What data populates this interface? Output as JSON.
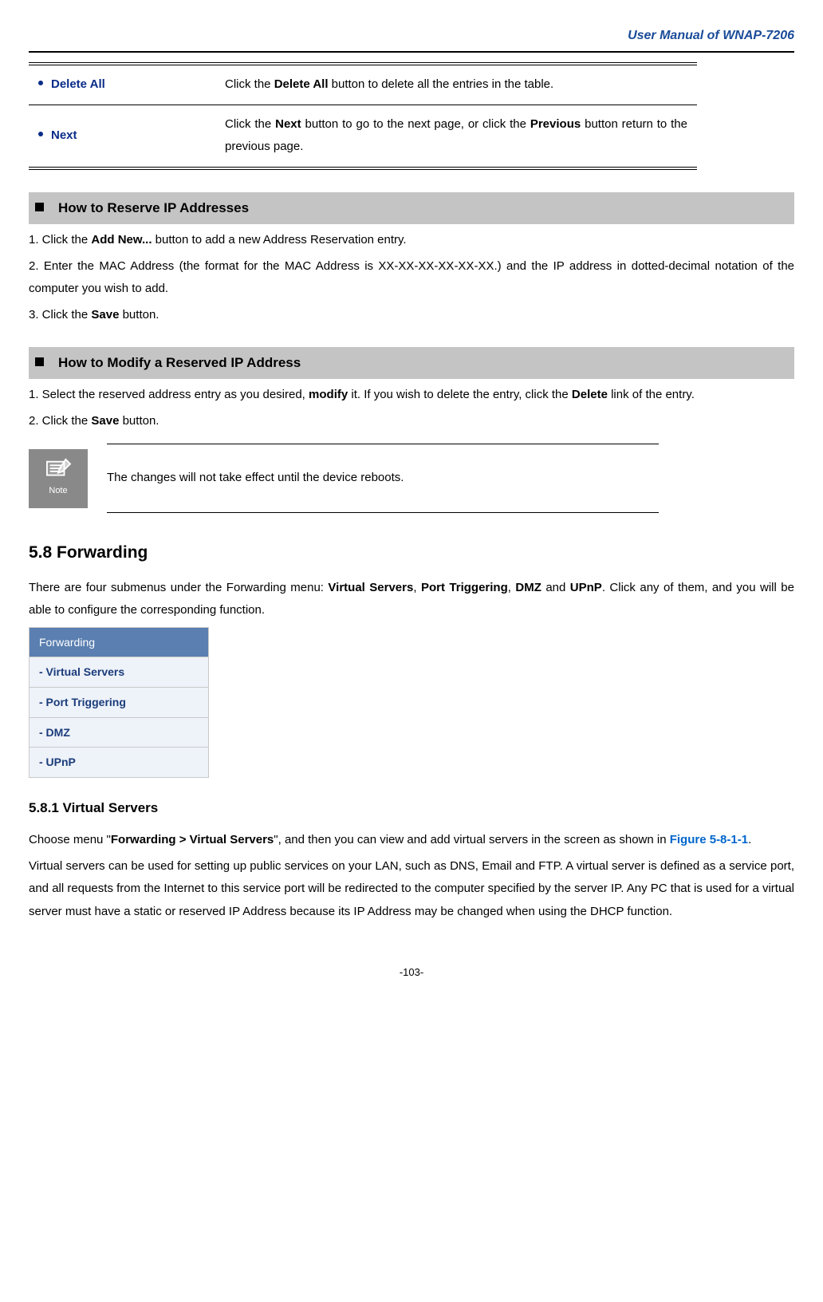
{
  "header": {
    "title": "User Manual of WNAP-7206"
  },
  "defTable": {
    "rows": [
      {
        "label": "Delete All",
        "desc_pre": "Click the ",
        "b1": "Delete All",
        "desc_post": " button to delete all the entries in the table."
      },
      {
        "label": "Next",
        "desc_pre": "Click the ",
        "b1": "Next",
        "desc_mid": " button to go to the next page, or click the ",
        "b2": "Previous",
        "desc_post": " button return to the previous page."
      }
    ]
  },
  "section1": {
    "title": "How to Reserve IP Addresses",
    "step1_pre": "1. Click the ",
    "step1_b": "Add New...",
    "step1_post": " button to add a new Address Reservation entry.",
    "step2": "2. Enter the MAC Address (the format for the MAC Address is XX-XX-XX-XX-XX-XX.) and the IP address in dotted-decimal notation of the computer you wish to add.",
    "step3_pre": "3. Click the ",
    "step3_b": "Save",
    "step3_post": " button."
  },
  "section2": {
    "title": "How to Modify a Reserved IP Address",
    "step1_pre": "1. Select the reserved address entry as you desired, ",
    "step1_b1": "modify",
    "step1_mid": " it. If you wish to delete the entry, click the ",
    "step1_b2": "Delete",
    "step1_post": " link of the entry.",
    "step2_pre": "2. Click the ",
    "step2_b": "Save",
    "step2_post": " button."
  },
  "note": {
    "label": "Note",
    "text": "The changes will not take effect until the device reboots."
  },
  "forwarding": {
    "heading": "5.8  Forwarding",
    "intro_pre": "There are four submenus under the Forwarding menu: ",
    "m1": "Virtual Servers",
    "c1": ", ",
    "m2": "Port Triggering",
    "c2": ", ",
    "m3": "DMZ",
    "c3": " and ",
    "m4": "UPnP",
    "intro_post": ". Click any of them, and you will be able to configure the corresponding function.",
    "menu": {
      "header": "Forwarding",
      "items": [
        "- Virtual Servers",
        "- Port Triggering",
        "- DMZ",
        "- UPnP"
      ]
    }
  },
  "virtualServers": {
    "heading": "5.8.1  Virtual Servers",
    "p1_pre": "Choose menu \"",
    "p1_b": "Forwarding > Virtual Servers",
    "p1_mid": "\", and then you can view and add virtual servers in the screen as shown in ",
    "p1_link": "Figure 5-8-1-1",
    "p1_post": ".",
    "p2": "Virtual servers can be used for setting up public services on your LAN, such as DNS, Email and FTP. A virtual server is defined as a service port, and all requests from the Internet to this service port will be redirected to the computer specified by the server IP. Any PC that is used for a virtual server must have a static or reserved IP Address because its IP Address may be changed when using the DHCP function."
  },
  "pageNum": "-103-"
}
